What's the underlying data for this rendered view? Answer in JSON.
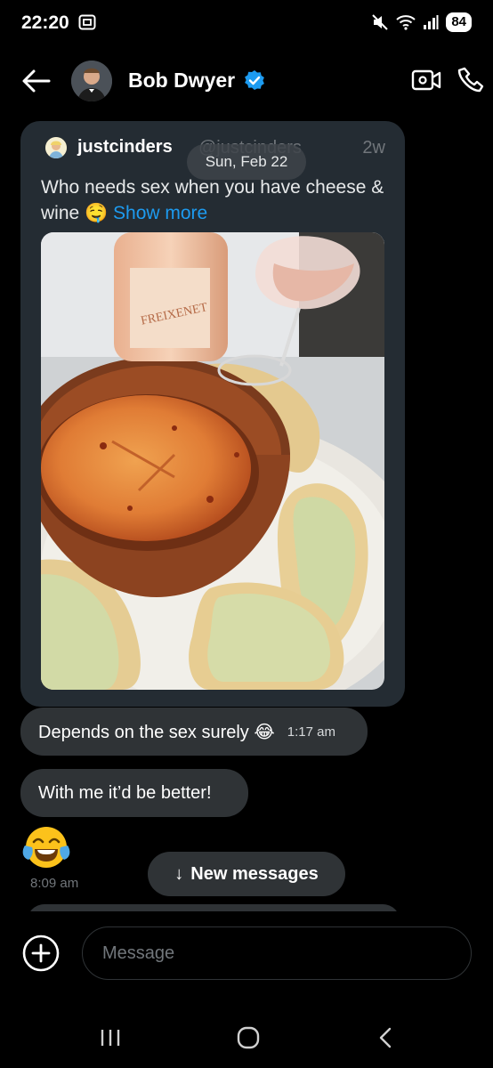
{
  "status_bar": {
    "time": "22:20",
    "battery": "84",
    "icons": [
      "screenshot-icon",
      "mute-icon",
      "wifi-icon",
      "signal-icon",
      "battery-icon"
    ]
  },
  "header": {
    "name": "Bob Dwyer",
    "verified": true,
    "icons": [
      "back-arrow-icon",
      "video-call-icon",
      "phone-icon"
    ]
  },
  "date_divider": "Sun, Feb 22",
  "shared_post": {
    "author": "justcinders",
    "handle": "@justcinders",
    "age": "2w",
    "text": "Who needs sex when you have cheese & wine 🤤",
    "show_more": "Show more",
    "image_description_icon": "baked-cheese-and-wine-photo",
    "bottle_label": "FREIXENET"
  },
  "messages": [
    {
      "text": "Depends on the sex surely 😂",
      "time": "1:17 am"
    },
    {
      "text": "With me it’d be better!",
      "time": ""
    },
    {
      "text": "😂",
      "time": "8:09 am"
    }
  ],
  "new_messages_button": {
    "arrow": "↓",
    "label": "New messages"
  },
  "composer": {
    "placeholder": "Message"
  },
  "nav": [
    "recents-icon",
    "home-icon",
    "back-icon"
  ],
  "colors": {
    "bubble": "#2f3336",
    "card": "#242c33",
    "accent": "#1d9bf0",
    "background": "#000000"
  }
}
